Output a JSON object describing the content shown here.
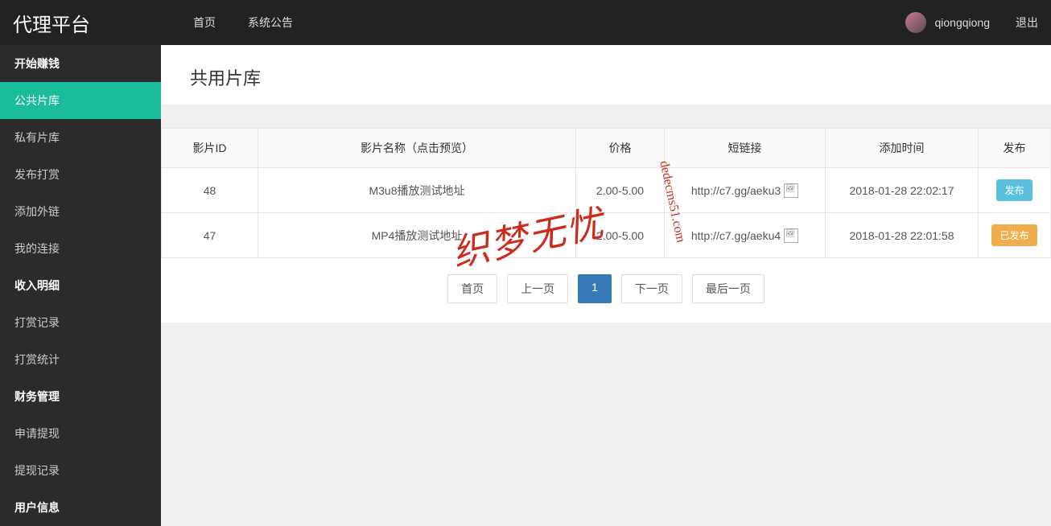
{
  "header": {
    "brand": "代理平台",
    "nav": {
      "home": "首页",
      "notice": "系统公告"
    },
    "username": "qiongqiong",
    "logout": "退出"
  },
  "sidebar": {
    "groups": [
      {
        "header": "开始赚钱",
        "items": [
          "公共片库",
          "私有片库",
          "发布打赏",
          "添加外链",
          "我的连接"
        ]
      },
      {
        "header": "收入明细",
        "items": [
          "打赏记录",
          "打赏统计"
        ]
      },
      {
        "header": "财务管理",
        "items": [
          "申请提现",
          "提现记录"
        ]
      },
      {
        "header": "用户信息",
        "items": []
      }
    ],
    "active": "公共片库"
  },
  "page": {
    "title": "共用片库"
  },
  "table": {
    "headers": {
      "id": "影片ID",
      "name": "影片名称（点击预览）",
      "price": "价格",
      "shortlink": "短链接",
      "time": "添加时间",
      "publish": "发布"
    },
    "rows": [
      {
        "id": "48",
        "name": "M3u8播放测试地址",
        "price": "2.00-5.00",
        "link": "http://c7.gg/aeku3",
        "img_alt": "点",
        "time": "2018-01-28 22:02:17",
        "btn": "发布",
        "btn_class": "btn-blue"
      },
      {
        "id": "47",
        "name": "MP4播放测试地址",
        "price": "2.00-5.00",
        "link": "http://c7.gg/aeku4",
        "img_alt": "点",
        "time": "2018-01-28 22:01:58",
        "btn": "已发布",
        "btn_class": "btn-orange"
      }
    ]
  },
  "pagination": {
    "first": "首页",
    "prev": "上一页",
    "current": "1",
    "next": "下一页",
    "last": "最后一页"
  },
  "watermark": {
    "zh": "织梦无忧",
    "en": "dedecms51.com"
  }
}
